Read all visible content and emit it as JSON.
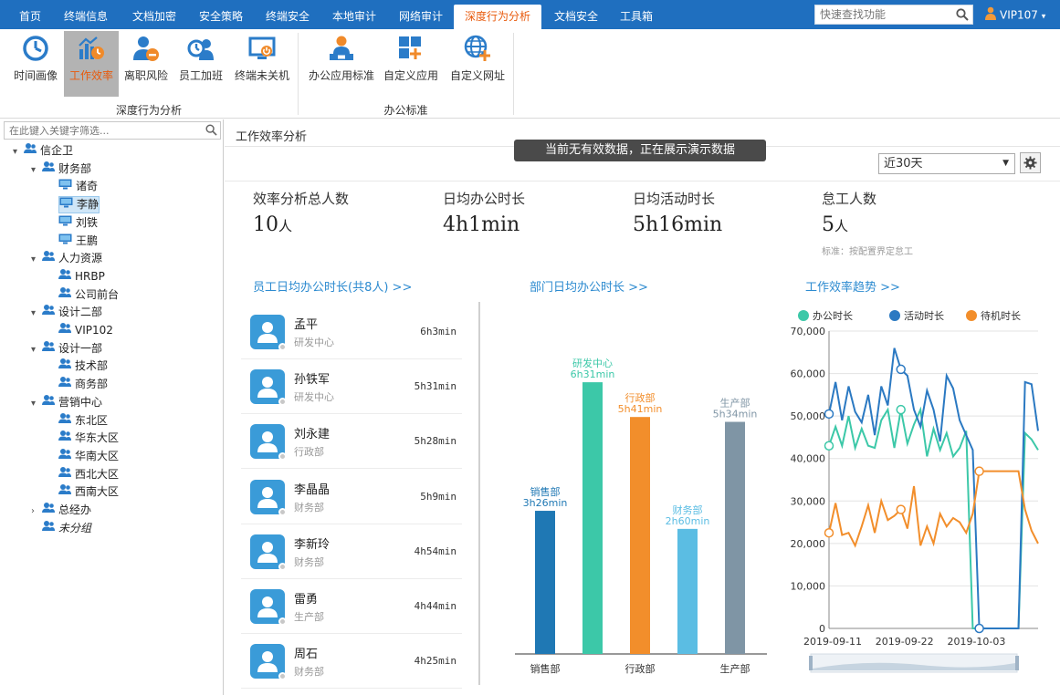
{
  "nav": {
    "tabs": [
      {
        "label": "首页",
        "active": false
      },
      {
        "label": "终端信息",
        "active": false
      },
      {
        "label": "文档加密",
        "active": false
      },
      {
        "label": "安全策略",
        "active": false
      },
      {
        "label": "终端安全",
        "active": false
      },
      {
        "label": "本地审计",
        "active": false
      },
      {
        "label": "网络审计",
        "active": false
      },
      {
        "label": "深度行为分析",
        "active": true
      },
      {
        "label": "文档安全",
        "active": false
      },
      {
        "label": "工具箱",
        "active": false
      }
    ],
    "search_placeholder": "快速查找功能",
    "user": "VIP107"
  },
  "ribbon": {
    "buttons": [
      {
        "label": "时间画像",
        "icon": "clock-icon",
        "active": false
      },
      {
        "label": "工作效率",
        "icon": "efficiency-chart-icon",
        "active": true
      },
      {
        "label": "离职风险",
        "icon": "user-remove-icon",
        "active": false
      },
      {
        "label": "员工加班",
        "icon": "overtime-user-icon",
        "active": false
      },
      {
        "label": "终端未关机",
        "icon": "monitor-power-icon",
        "active": false
      },
      {
        "label": "办公应用标准",
        "icon": "user-desk-icon",
        "active": false
      },
      {
        "label": "自定义应用",
        "icon": "add-app-icon",
        "active": false
      },
      {
        "label": "自定义网址",
        "icon": "add-globe-icon",
        "active": false
      }
    ],
    "groups": [
      {
        "label": "深度行为分析"
      },
      {
        "label": "办公标准"
      }
    ]
  },
  "sidebar": {
    "filter_placeholder": "在此键入关键字筛选...",
    "nodes": [
      {
        "label": "信企卫",
        "type": "group",
        "level": 0,
        "arrow": "⌄"
      },
      {
        "label": "财务部",
        "type": "group",
        "level": 1,
        "arrow": "⌄"
      },
      {
        "label": "诸奇",
        "type": "pc",
        "level": 2,
        "arrow": ""
      },
      {
        "label": "李静",
        "type": "pc",
        "level": 2,
        "arrow": "",
        "selected": true
      },
      {
        "label": "刘铁",
        "type": "pc",
        "level": 2,
        "arrow": ""
      },
      {
        "label": "王鹏",
        "type": "pc",
        "level": 2,
        "arrow": ""
      },
      {
        "label": "人力资源",
        "type": "group",
        "level": 1,
        "arrow": "⌄"
      },
      {
        "label": "HRBP",
        "type": "group",
        "level": 2,
        "arrow": ""
      },
      {
        "label": "公司前台",
        "type": "group",
        "level": 2,
        "arrow": ""
      },
      {
        "label": "设计二部",
        "type": "group",
        "level": 1,
        "arrow": "⌄"
      },
      {
        "label": "VIP102",
        "type": "group",
        "level": 2,
        "arrow": ""
      },
      {
        "label": "设计一部",
        "type": "group",
        "level": 1,
        "arrow": "⌄"
      },
      {
        "label": "技术部",
        "type": "group",
        "level": 2,
        "arrow": ""
      },
      {
        "label": "商务部",
        "type": "group",
        "level": 2,
        "arrow": ""
      },
      {
        "label": "营销中心",
        "type": "group",
        "level": 1,
        "arrow": "⌄"
      },
      {
        "label": "东北区",
        "type": "group",
        "level": 2,
        "arrow": ""
      },
      {
        "label": "华东大区",
        "type": "group",
        "level": 2,
        "arrow": ""
      },
      {
        "label": "华南大区",
        "type": "group",
        "level": 2,
        "arrow": ""
      },
      {
        "label": "西北大区",
        "type": "group",
        "level": 2,
        "arrow": ""
      },
      {
        "label": "西南大区",
        "type": "group",
        "level": 2,
        "arrow": ""
      },
      {
        "label": "总经办",
        "type": "group",
        "level": 1,
        "arrow": "›"
      },
      {
        "label": "未分组",
        "type": "group",
        "level": 1,
        "arrow": "",
        "italic": true
      }
    ]
  },
  "main": {
    "title": "工作效率分析",
    "banner": "当前无有效数据，正在展示演示数据",
    "range": "近30天",
    "kpis": [
      {
        "label": "效率分析总人数",
        "value": "10",
        "unit": "人",
        "note": ""
      },
      {
        "label": "日均办公时长",
        "value": "4h1min",
        "unit": "",
        "note": ""
      },
      {
        "label": "日均活动时长",
        "value": "5h16min",
        "unit": "",
        "note": ""
      },
      {
        "label": "怠工人数",
        "value": "5",
        "unit": "人",
        "note": "标准：按配置界定怠工"
      }
    ],
    "emp_title": "员工日均办公时长(共8人)  >>",
    "dept_title": "部门日均办公时长  >>",
    "trend_title": "工作效率趋势  >>",
    "employees": [
      {
        "name": "孟平",
        "dept": "研发中心",
        "time": "6h3min"
      },
      {
        "name": "孙铁军",
        "dept": "研发中心",
        "time": "5h31min"
      },
      {
        "name": "刘永建",
        "dept": "行政部",
        "time": "5h28min"
      },
      {
        "name": "李晶晶",
        "dept": "财务部",
        "time": "5h9min"
      },
      {
        "name": "李新玲",
        "dept": "财务部",
        "time": "4h54min"
      },
      {
        "name": "雷勇",
        "dept": "生产部",
        "time": "4h44min"
      },
      {
        "name": "周石",
        "dept": "财务部",
        "time": "4h25min"
      }
    ]
  },
  "chart_data": [
    {
      "type": "bar",
      "categories": [
        "销售部",
        "研发中心",
        "行政部",
        "财务部",
        "生产部"
      ],
      "axis_labels": [
        "销售部",
        "",
        "行政部",
        "",
        "生产部"
      ],
      "values": [
        206,
        391,
        341,
        180,
        334
      ],
      "value_labels": [
        "3h26min",
        "6h31min",
        "5h41min",
        "2h60min",
        "5h34min"
      ],
      "colors": [
        "#1f78b4",
        "#3cc8a8",
        "#f28e2b",
        "#5bbde3",
        "#7f95a5"
      ],
      "ylim": [
        0,
        420
      ]
    },
    {
      "type": "line",
      "x_labels": [
        "2019-09-11",
        "2019-09-22",
        "2019-10-03"
      ],
      "ylim": [
        0,
        70000
      ],
      "yticks": [
        "0",
        "10,000",
        "20,000",
        "30,000",
        "40,000",
        "50,000",
        "60,000",
        "70,000"
      ],
      "grid": true,
      "legend": "top",
      "series": [
        {
          "name": "办公时长",
          "color": "#3cc8a8",
          "values": [
            43000,
            47500,
            43000,
            50000,
            42500,
            47000,
            43000,
            42500,
            49000,
            51500,
            42500,
            51500,
            43500,
            48000,
            51500,
            40500,
            47000,
            42000,
            46000,
            40500,
            42500,
            46500,
            0,
            0,
            0,
            0,
            0,
            0,
            0,
            0,
            46000,
            44500,
            42000
          ]
        },
        {
          "name": "活动时长",
          "color": "#2b79c2",
          "values": [
            50500,
            58000,
            49000,
            57000,
            51000,
            48500,
            55000,
            45500,
            57000,
            52500,
            66000,
            61000,
            59500,
            51500,
            47500,
            56000,
            51500,
            44000,
            59500,
            56500,
            49000,
            45500,
            42000,
            0,
            0,
            0,
            0,
            0,
            0,
            0,
            58000,
            57500,
            46500
          ]
        },
        {
          "name": "待机时长",
          "color": "#f28e2b",
          "values": [
            22500,
            29500,
            22000,
            22500,
            19500,
            24000,
            29000,
            22500,
            30000,
            25500,
            26500,
            28000,
            23500,
            33500,
            19500,
            24000,
            20000,
            27000,
            24000,
            26000,
            25000,
            22500,
            27000,
            37000,
            37000,
            37000,
            37000,
            37000,
            37000,
            37000,
            28000,
            23000,
            20000
          ]
        }
      ]
    }
  ]
}
